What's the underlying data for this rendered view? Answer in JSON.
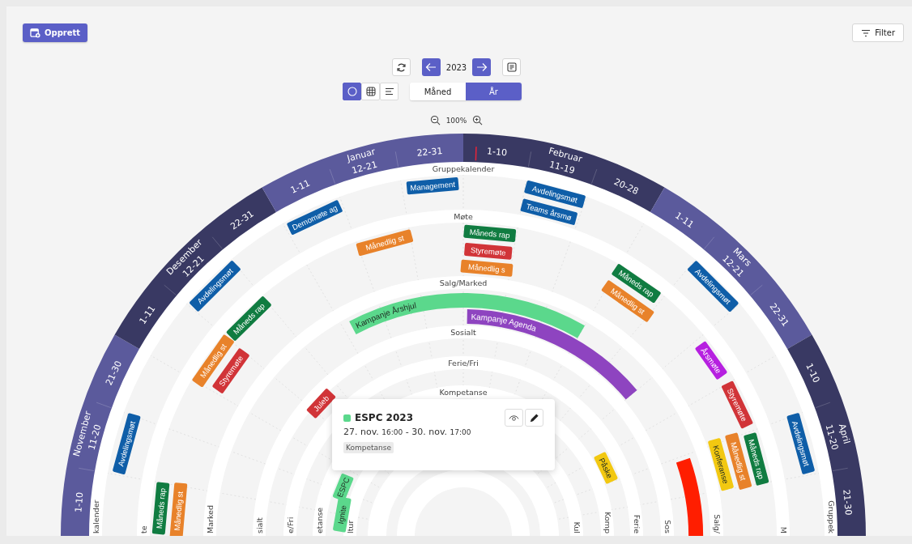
{
  "toolbar": {
    "create_button": "Opprett",
    "filter_button": "Filter"
  },
  "navigation": {
    "year": "2023"
  },
  "views": [
    {
      "kind": "wheel",
      "selected": true
    },
    {
      "kind": "grid",
      "selected": false
    },
    {
      "kind": "list",
      "selected": false
    }
  ],
  "periods": [
    {
      "label": "Måned",
      "selected": false
    },
    {
      "label": "År",
      "selected": true
    }
  ],
  "zoom": {
    "value": "100%"
  },
  "months": [
    {
      "name": "November",
      "periods": [
        "1-10",
        "11-20",
        "21-30"
      ]
    },
    {
      "name": "Desember",
      "periods": [
        "1-11",
        "12-21",
        "22-31"
      ]
    },
    {
      "name": "Januar",
      "periods": [
        "1-11",
        "12-21",
        "22-31"
      ]
    },
    {
      "name": "Februar",
      "periods": [
        "1-10",
        "11-19",
        "20-28"
      ]
    },
    {
      "name": "Mars",
      "periods": [
        "1-11",
        "12-21",
        "22-31"
      ]
    },
    {
      "name": "April",
      "periods": [
        "1-10",
        "11-20",
        "21-30"
      ]
    }
  ],
  "categories": [
    {
      "label": "Gruppekalender",
      "label_left": "kalender",
      "label_right": "Gruppek",
      "events": [
        {
          "kind": "chip",
          "title": "Avdelingsmøt",
          "color": "#0f5ea8"
        },
        {
          "kind": "chip",
          "title": "Avdelingsmøt",
          "color": "#0f5ea8"
        },
        {
          "kind": "chip",
          "title": "Demomøte ag",
          "color": "#0f5ea8"
        },
        {
          "kind": "chip",
          "title": "Management",
          "color": "#0f5ea8"
        },
        {
          "kind": "chip",
          "title": "Avdelingsmøt",
          "color": "#0f5ea8"
        },
        {
          "kind": "chip",
          "title": "Teams årsmø",
          "color": "#0f5ea8"
        },
        {
          "kind": "chip",
          "title": "Avdelingsmøt",
          "color": "#0f5ea8"
        },
        {
          "kind": "chip",
          "title": "Avdelingsmøt",
          "color": "#0f5ea8"
        }
      ]
    },
    {
      "label": "Møte",
      "label_left": "te",
      "label_right": "M",
      "events": [
        {
          "kind": "chip",
          "title": "Måneds rap",
          "color": "#107c41"
        },
        {
          "kind": "chip",
          "title": "Månedlig st",
          "color": "#e8822a"
        },
        {
          "kind": "chip",
          "title": "Månedlig st",
          "color": "#e8822a"
        },
        {
          "kind": "chip",
          "title": "Styremøte",
          "color": "#d13438"
        },
        {
          "kind": "chip",
          "title": "Måneds rap",
          "color": "#107c41"
        },
        {
          "kind": "chip",
          "title": "Månedlig st",
          "color": "#e8822a"
        },
        {
          "kind": "chip",
          "title": "Måneds rap",
          "color": "#107c41"
        },
        {
          "kind": "chip",
          "title": "Styremøte",
          "color": "#d13438"
        },
        {
          "kind": "chip",
          "title": "Månedlig s",
          "color": "#e8822a"
        },
        {
          "kind": "chip",
          "title": "Måneds rap",
          "color": "#107c41"
        },
        {
          "kind": "chip",
          "title": "Månedlig st",
          "color": "#e8822a"
        },
        {
          "kind": "chip",
          "title": "Årsmøte",
          "color": "#b620e0"
        },
        {
          "kind": "chip",
          "title": "Styremøte",
          "color": "#d13438"
        },
        {
          "kind": "chip",
          "title": "Konferanse",
          "color": "#f2c811"
        },
        {
          "kind": "chip",
          "title": "Månedlig st",
          "color": "#e8822a"
        },
        {
          "kind": "chip",
          "title": "Måneds rap",
          "color": "#107c41"
        }
      ]
    },
    {
      "label": "Salg/Marked",
      "label_left": "Marked",
      "label_right": "Salg/",
      "events": [
        {
          "kind": "bar",
          "title": "Kampanje Årshjul",
          "color": "#5bd88c"
        },
        {
          "kind": "bar",
          "title": "Kampanje Agenda",
          "color": "#8e44c0"
        },
        {
          "kind": "bar",
          "color": "#ff1e00"
        }
      ]
    },
    {
      "label": "Sosialt",
      "label_left": "sialt",
      "label_right": "Sos",
      "events": [
        {
          "kind": "chip",
          "title": "Juleb",
          "color": "#d13438"
        }
      ]
    },
    {
      "label": "Ferie/Fri",
      "label_left": "e/Fri",
      "label_right": "Ferie",
      "events": [
        {
          "kind": "chip",
          "title": "Påske",
          "color": "#f2c811"
        }
      ]
    },
    {
      "label": "Kompetanse",
      "label_left": "etanse",
      "label_right": "Komp",
      "events": [
        {
          "kind": "chip",
          "title": "ESPC",
          "color": "#5bd88c"
        },
        {
          "kind": "chip",
          "title": "Ignite",
          "color": "#5bd88c"
        }
      ]
    },
    {
      "label_left": "ltur",
      "label_right": "Kul"
    }
  ],
  "popup": {
    "title": "ESPC 2023",
    "color": "#5bd88c",
    "start_date": "27. nov.",
    "start_time": "16:00",
    "separator": "-",
    "end_date": "30. nov.",
    "end_time": "17:00",
    "tag": "Kompetanse"
  }
}
